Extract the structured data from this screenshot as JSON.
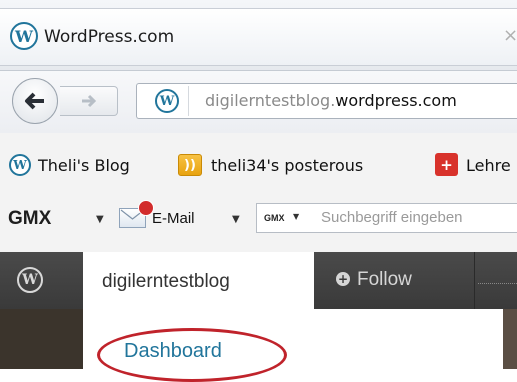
{
  "browser": {
    "tab_title": "WordPress.com",
    "tab_close": "×",
    "url_prefix": "digilerntestblog.",
    "url_domain": "wordpress.com"
  },
  "bookmarks": [
    {
      "label": "Theli's Blog",
      "icon": "wordpress-icon"
    },
    {
      "label": "theli34's posterous",
      "icon": "rss-icon"
    },
    {
      "label": "Lehre",
      "icon": "red-cross-icon"
    }
  ],
  "gmx": {
    "logo": "GMX",
    "mail_label": "E-Mail",
    "mini_logo": "GMX",
    "search_placeholder": "Suchbegriff eingeben"
  },
  "adminbar": {
    "site_name": "digilerntestblog",
    "follow_label": "Follow"
  },
  "menu": {
    "dashboard_label": "Dashboard"
  },
  "colors": {
    "wp_blue": "#21759b",
    "admin_bar": "#3f3f3f",
    "highlight_red": "#c0232b"
  }
}
